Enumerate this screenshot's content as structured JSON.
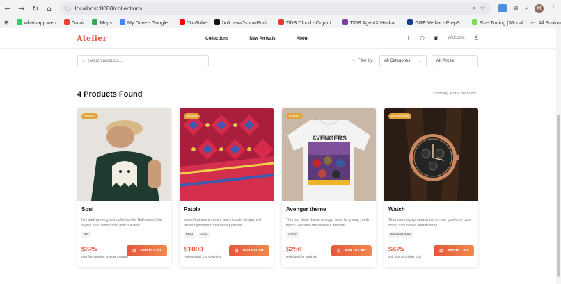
{
  "browser": {
    "url": "localhost:8080/collections",
    "profile_initial": "M",
    "bookmarks": [
      {
        "label": "whatsapp web",
        "color": "#25d366"
      },
      {
        "label": "Gmail",
        "color": "#ea4335"
      },
      {
        "label": "Maps",
        "color": "#34a853"
      },
      {
        "label": "My Drive - Google...",
        "color": "#4285f4"
      },
      {
        "label": "YouTube",
        "color": "#ff0000"
      },
      {
        "label": "bolt.new/?showPrici...",
        "color": "#111111"
      },
      {
        "label": "TiDB Cloud - Organi...",
        "color": "#e53935"
      },
      {
        "label": "TiDB AgentX Hackat...",
        "color": "#7b3fa0"
      },
      {
        "label": "GRE Verbal - PrepS...",
        "color": "#1a3c8c"
      },
      {
        "label": "Fine Tuning | Modal",
        "color": "#7ed957"
      }
    ],
    "all_bookmarks": "All Bookmarks"
  },
  "site": {
    "logo": "Atelier",
    "nav": [
      "Collections",
      "New Arrivals",
      "About"
    ],
    "welcome": "Welcome"
  },
  "filters": {
    "search_placeholder": "Search products...",
    "filter_label": "Filter by:",
    "category": "All Categories",
    "price": "All Prices"
  },
  "results": {
    "title": "4 Products Found",
    "count": "Showing 4 of 4 products"
  },
  "add_label": "Add to Cart",
  "products": [
    {
      "badge": "modern",
      "title": "Soul",
      "desc": "It is dark green ghost collection for Halloween Stay stylish and comfortable with our dark...",
      "tags": [
        "Silk"
      ],
      "price": "$625",
      "note": "Use fine grained powder to wash"
    },
    {
      "badge": "vintage",
      "title": "Patola",
      "desc": "saree features a vibrant and intricate design, with distinct geometric and floral patterns...",
      "tags": [
        "Dyes",
        "fabric"
      ],
      "price": "$1000",
      "note": "Professional Dry Cleaning"
    },
    {
      "badge": "modern",
      "title": "Avenger theme",
      "desc": "This is a white theme avenger tshirt for young youth trend Celebrate the Marvel Cinematic...",
      "tags": [
        "cotton"
      ],
      "price": "$256",
      "note": "Use liquid for washing"
    },
    {
      "badge": "accessories",
      "title": "Watch",
      "desc": "Titan chronograph watch with a rose gold-tone case and a dark brown leather strap...",
      "tags": [
        "stainless steel"
      ],
      "price": "$425",
      "note": "soft, dry microfiber cloth"
    }
  ],
  "colors": {
    "accent": "#e4573d",
    "badge": "#e0a43a"
  }
}
